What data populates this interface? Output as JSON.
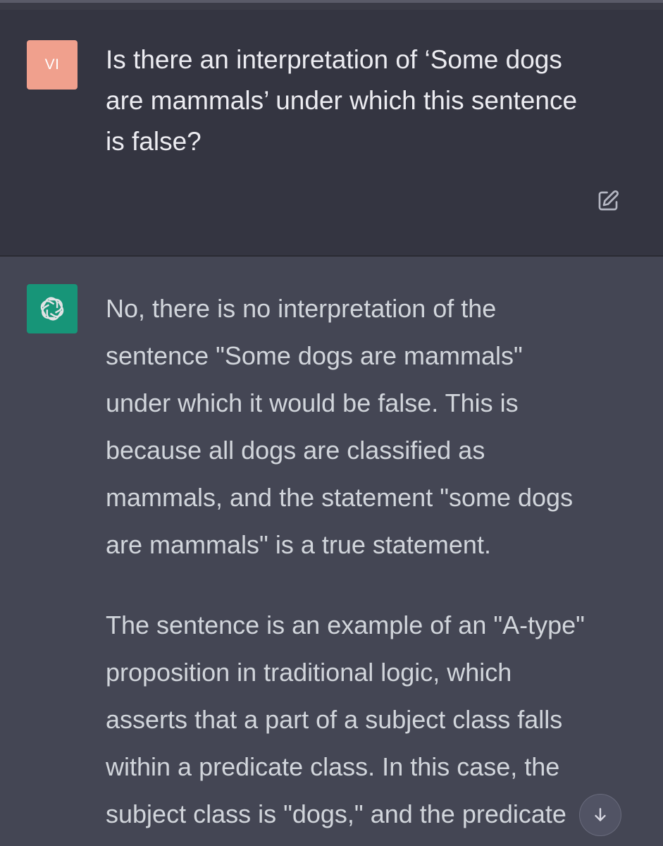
{
  "conversation": {
    "user_message": {
      "avatar_initials": "VI",
      "text_lines": [
        "Is there an interpretation of ‘Some dogs",
        "are mammals’ under which this sentence",
        "is false?"
      ]
    },
    "assistant_message": {
      "paragraph_1_lines": [
        "No, there is no interpretation of the",
        "sentence \"Some dogs are mammals\"",
        "under which it would be false. This is",
        "because all dogs are classified as",
        "mammals, and the statement \"some dogs",
        "are mammals\" is a true statement."
      ],
      "paragraph_2_lines": [
        "The sentence is an example of an \"A-type\"",
        "proposition in traditional logic, which",
        "asserts that a part of a subject class falls",
        "within a predicate class. In this case, the",
        "subject class is \"dogs,\" and the predicate"
      ]
    }
  },
  "icons": {
    "edit": "edit-icon",
    "assistant_logo": "openai-logo-icon",
    "scroll_down": "arrow-down-icon"
  },
  "colors": {
    "user_background": "#343541",
    "assistant_background": "#444654",
    "user_avatar": "#f0a08d",
    "assistant_avatar": "#10a37f",
    "text_user": "#ececf1",
    "text_assistant": "#d1d5db"
  }
}
